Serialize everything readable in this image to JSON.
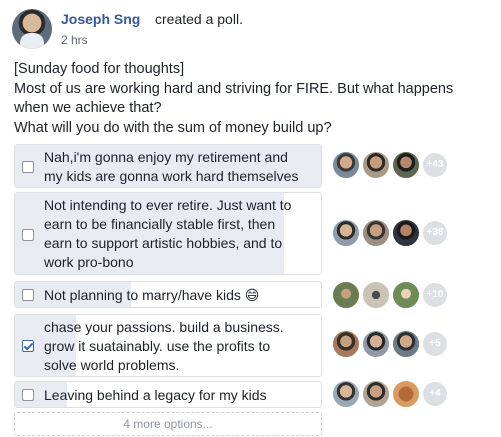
{
  "post": {
    "author": "Joseph Sng",
    "action": "created a poll.",
    "timestamp": "2 hrs",
    "text_lines": [
      "[Sunday food for thoughts]",
      "Most of us are working hard and striving for FIRE. But what happens",
      "when we achieve that?",
      "What will you do with the sum of money build up?"
    ]
  },
  "poll": {
    "options": [
      {
        "lines": [
          "Nah,i'm gonna enjoy my retirement and",
          "my kids are gonna work hard themselves"
        ],
        "checked": false,
        "more_voters": "+43",
        "fill_fraction": 1.0
      },
      {
        "lines": [
          "Not intending to ever retire. Just want to",
          "earn to be financially stable first, then",
          "earn to support artistic hobbies, and to",
          "work pro-bono"
        ],
        "checked": false,
        "more_voters": "+38",
        "fill_fraction": 0.88
      },
      {
        "lines": [
          "Not planning to marry/have kids 😄"
        ],
        "checked": false,
        "more_voters": "+10",
        "fill_fraction": 0.38
      },
      {
        "lines": [
          "chase your passions. build a business.",
          "grow it suatainably. use the profits to",
          "solve world problems."
        ],
        "checked": true,
        "more_voters": "+5",
        "fill_fraction": 0.2
      },
      {
        "lines": [
          "Leaving behind a legacy for my kids"
        ],
        "checked": false,
        "more_voters": "+4",
        "fill_fraction": 0.17
      }
    ],
    "more_options_label": "4 more options..."
  },
  "colors": {
    "author_link": "#385898",
    "fill": "#e9ebf3",
    "checkbox_checked": "#4267b2"
  }
}
